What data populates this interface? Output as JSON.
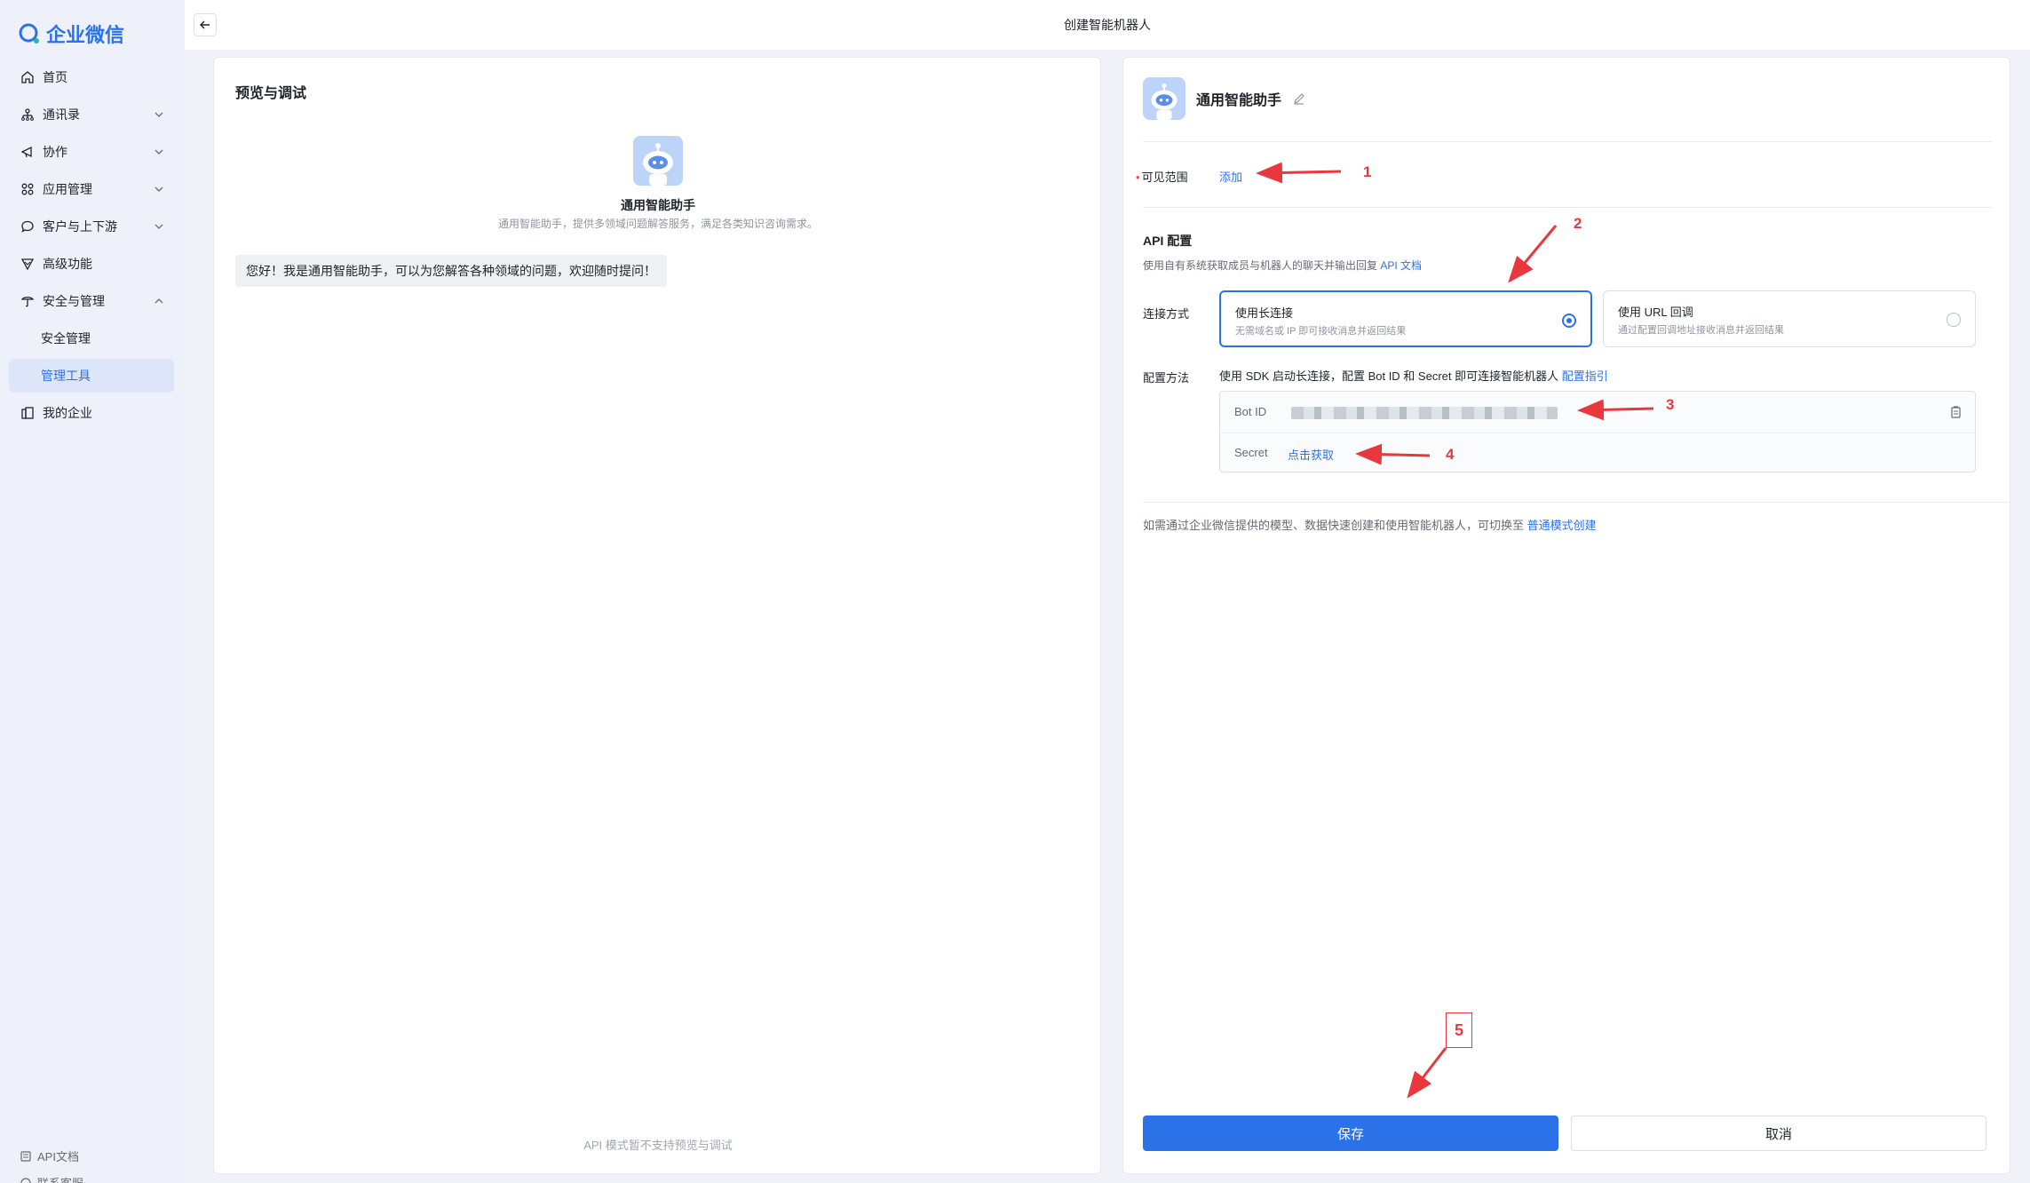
{
  "sidebar": {
    "logo_text": "企业微信",
    "items": [
      {
        "label": "首页",
        "icon": "home-icon"
      },
      {
        "label": "通讯录",
        "icon": "contacts-icon"
      },
      {
        "label": "协作",
        "icon": "collab-icon"
      },
      {
        "label": "应用管理",
        "icon": "apps-icon"
      },
      {
        "label": "客户与上下游",
        "icon": "chat-bubble-icon"
      },
      {
        "label": "高级功能",
        "icon": "advanced-icon"
      },
      {
        "label": "安全与管理",
        "icon": "security-icon"
      },
      {
        "label": "安全管理"
      },
      {
        "label": "管理工具"
      },
      {
        "label": "我的企业",
        "icon": "enterprise-icon"
      }
    ],
    "bottom": {
      "api_doc": "API文档",
      "contact": "联系客服"
    }
  },
  "topbar": {
    "title": "创建智能机器人"
  },
  "preview": {
    "title": "预览与调试",
    "bot_name": "通用智能助手",
    "bot_desc": "通用智能助手，提供多领域问题解答服务，满足各类知识咨询需求。",
    "greeting": "您好！我是通用智能助手，可以为您解答各种领域的问题，欢迎随时提问！",
    "footer": "API 模式暂不支持预览与调试"
  },
  "config": {
    "bot_name": "通用智能助手",
    "visibility_label": "可见范围",
    "visibility_add": "添加",
    "api_title": "API 配置",
    "api_desc": "使用自有系统获取成员与机器人的聊天并输出回复",
    "api_doc_link": "API 文档",
    "connect_label": "连接方式",
    "options": [
      {
        "title": "使用长连接",
        "sub": "无需域名或 IP 即可接收消息并返回结果",
        "selected": true
      },
      {
        "title": "使用 URL 回调",
        "sub": "通过配置回调地址接收消息并返回结果",
        "selected": false
      }
    ],
    "method_label": "配置方法",
    "method_desc": "使用 SDK 启动长连接，配置 Bot ID 和 Secret 即可连接智能机器人",
    "method_link": "配置指引",
    "bot_id_label": "Bot ID",
    "secret_label": "Secret",
    "secret_link": "点击获取",
    "normal_mode_text": "如需通过企业微信提供的模型、数据快速创建和使用智能机器人，可切换至",
    "normal_mode_link": "普通模式创建",
    "save": "保存",
    "cancel": "取消"
  },
  "annotations": [
    "1",
    "2",
    "3",
    "4",
    "5"
  ],
  "colors": {
    "accent": "#2b71e8",
    "annotation": "#e8383d",
    "sidebar_bg": "#eef1f9"
  }
}
